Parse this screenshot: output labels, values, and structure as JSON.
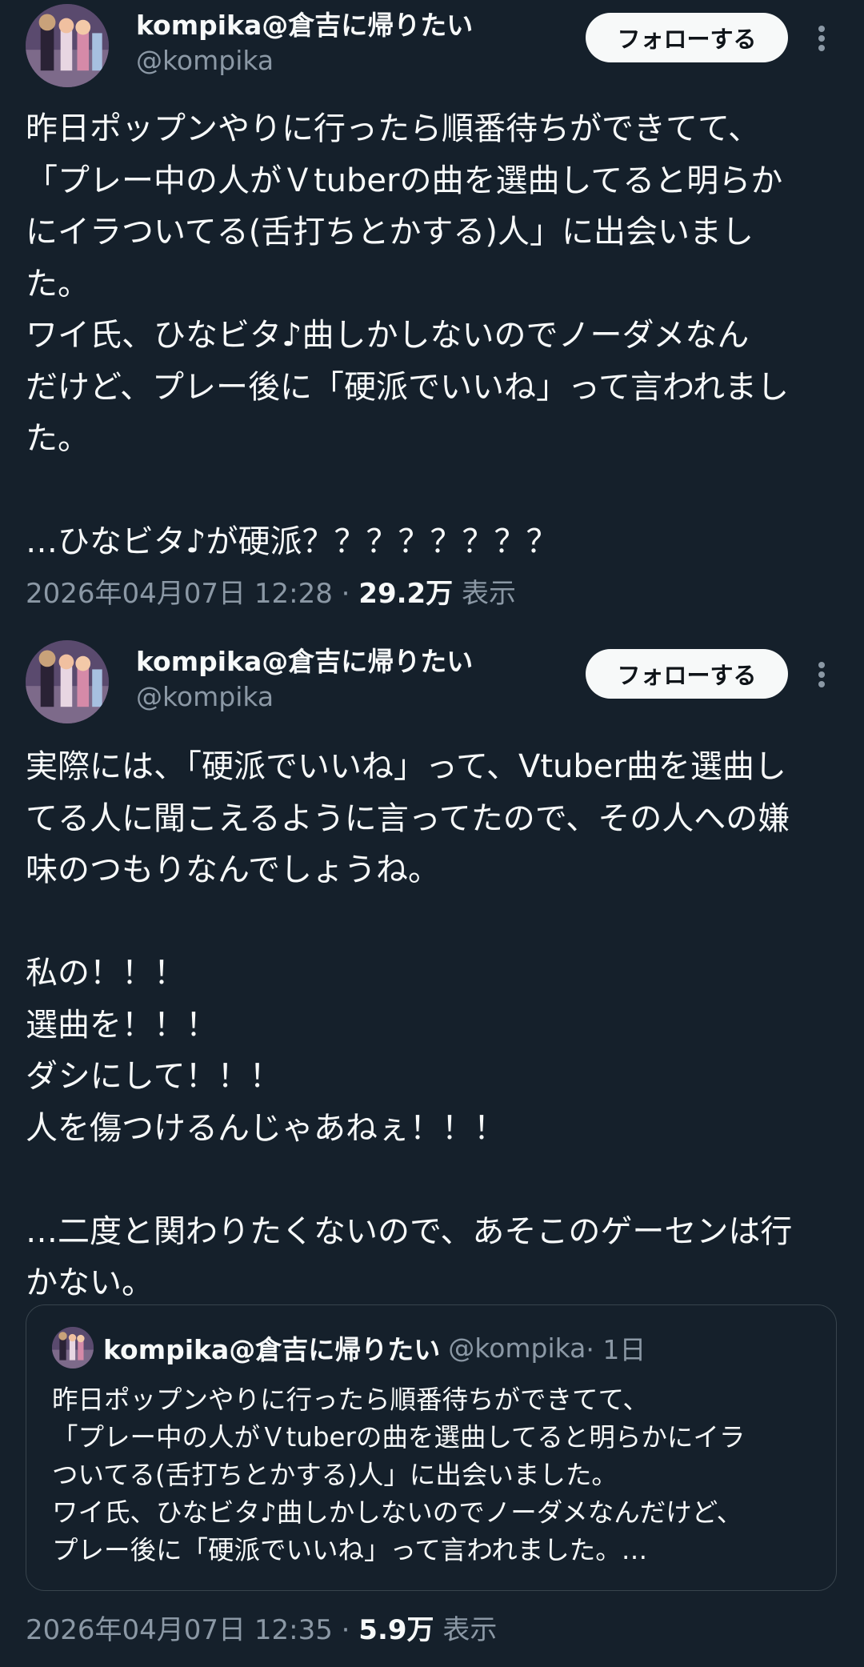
{
  "tweets": [
    {
      "display_name": "kompika@倉吉に帰りたい",
      "handle": "@kompika",
      "follow_label": "フォローする",
      "more_icon": "more-vertical-icon",
      "text": "昨日ポップンやりに行ったら順番待ちができてて、\n「プレー中の人がＶtuberの曲を選曲してると明らか\nにイラついてる(舌打ちとかする)人」に出会いまし\nた。\nワイ氏、ひなビタ♪曲しかしないのでノーダメなん\nだけど、プレー後に「硬派でいいね」って言われまし\nた。\n\n…ひなビタ♪が硬派？？？？？？？？",
      "timestamp": "2026年04月07日 12:28",
      "separator": "·",
      "views_count": "29.2万",
      "views_label": "表示"
    },
    {
      "display_name": "kompika@倉吉に帰りたい",
      "handle": "@kompika",
      "follow_label": "フォローする",
      "more_icon": "more-vertical-icon",
      "text": "実際には、「硬派でいいね」って、Vtuber曲を選曲し\nてる人に聞こえるように言ってたので、その人への嫌\n味のつもりなんでしょうね。\n\n私の！！！\n選曲を！！！\nダシにして！！！\n人を傷つけるんじゃあねぇ！！！\n\n…二度と関わりたくないので、あそこのゲーセンは行\nかない。",
      "quote": {
        "display_name": "kompika@倉吉に帰りたい",
        "handle": "@kompika",
        "time": "· 1日",
        "text": "昨日ポップンやりに行ったら順番待ちができてて、\n「プレー中の人がＶtuberの曲を選曲してると明らかにイラ\nついてる(舌打ちとかする)人」に出会いました。\nワイ氏、ひなビタ♪曲しかしないのでノーダメなんだけど、\nプレー後に「硬派でいいね」って言われました。…"
      },
      "timestamp": "2026年04月07日 12:35",
      "separator": "·",
      "views_count": "5.9万",
      "views_label": "表示"
    }
  ],
  "colors": {
    "background": "#15202b",
    "text_primary": "#f7f9f9",
    "text_secondary": "#8b98a5",
    "border": "#38444d",
    "button_bg": "#f7f9f9",
    "button_text": "#0f1419"
  }
}
